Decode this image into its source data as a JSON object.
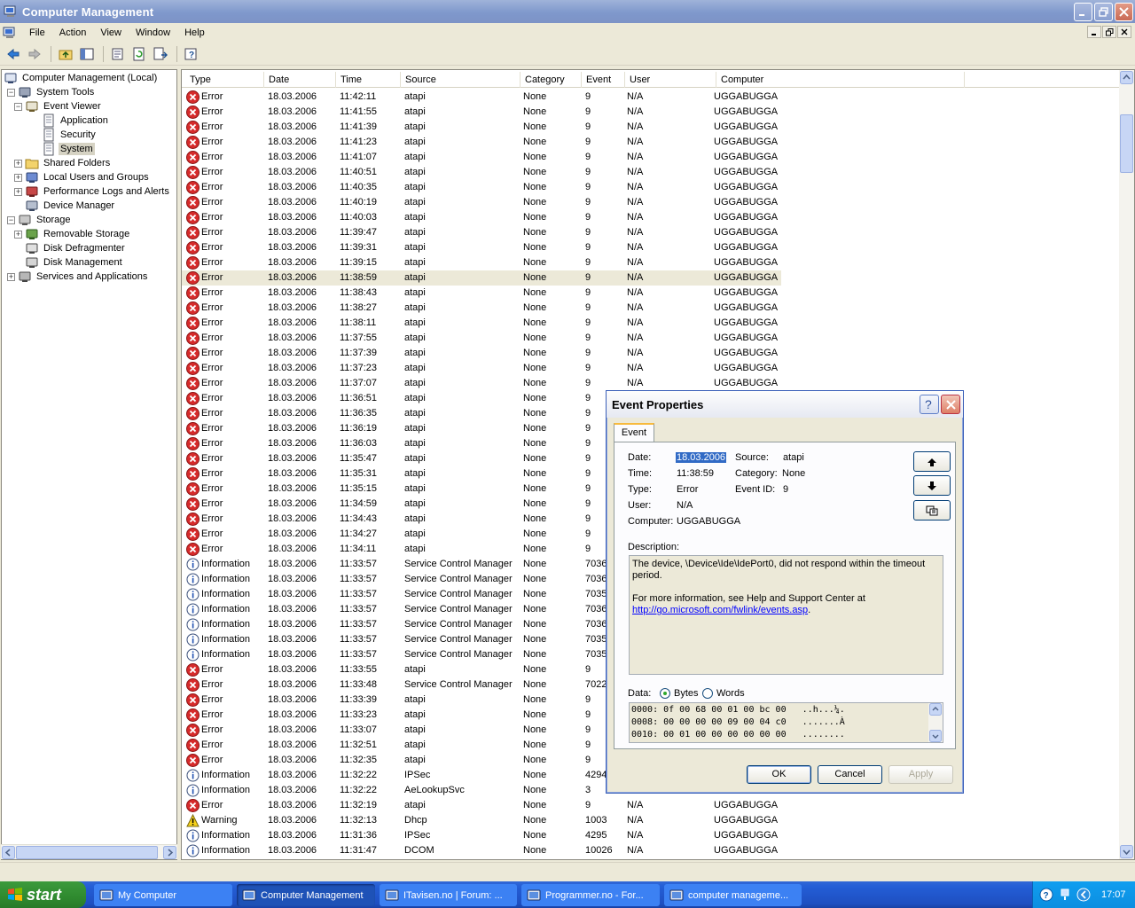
{
  "window": {
    "title": "Computer Management"
  },
  "menu": [
    "File",
    "Action",
    "View",
    "Window",
    "Help"
  ],
  "tree": [
    {
      "label": "Computer Management (Local)",
      "level": 0,
      "expander": "",
      "icon": "computer-icon"
    },
    {
      "label": "System Tools",
      "level": 1,
      "expander": "−",
      "icon": "tools-icon"
    },
    {
      "label": "Event Viewer",
      "level": 2,
      "expander": "−",
      "icon": "event-viewer-icon"
    },
    {
      "label": "Application",
      "level": 3,
      "expander": "",
      "icon": "log-icon"
    },
    {
      "label": "Security",
      "level": 3,
      "expander": "",
      "icon": "log-icon"
    },
    {
      "label": "System",
      "level": 3,
      "expander": "",
      "icon": "log-icon",
      "selected": true
    },
    {
      "label": "Shared Folders",
      "level": 2,
      "expander": "+",
      "icon": "folder-icon"
    },
    {
      "label": "Local Users and Groups",
      "level": 2,
      "expander": "+",
      "icon": "users-icon"
    },
    {
      "label": "Performance Logs and Alerts",
      "level": 2,
      "expander": "+",
      "icon": "performance-icon"
    },
    {
      "label": "Device Manager",
      "level": 2,
      "expander": "",
      "icon": "device-manager-icon"
    },
    {
      "label": "Storage",
      "level": 1,
      "expander": "−",
      "icon": "storage-icon"
    },
    {
      "label": "Removable Storage",
      "level": 2,
      "expander": "+",
      "icon": "removable-storage-icon"
    },
    {
      "label": "Disk Defragmenter",
      "level": 2,
      "expander": "",
      "icon": "defrag-icon"
    },
    {
      "label": "Disk Management",
      "level": 2,
      "expander": "",
      "icon": "disk-icon"
    },
    {
      "label": "Services and Applications",
      "level": 1,
      "expander": "+",
      "icon": "services-icon"
    }
  ],
  "columns": [
    "Type",
    "Date",
    "Time",
    "Source",
    "Category",
    "Event",
    "User",
    "Computer"
  ],
  "events": [
    {
      "type": "Error",
      "date": "18.03.2006",
      "time": "11:42:11",
      "source": "atapi",
      "category": "None",
      "event": "9",
      "user": "N/A",
      "computer": "UGGABUGGA"
    },
    {
      "type": "Error",
      "date": "18.03.2006",
      "time": "11:41:55",
      "source": "atapi",
      "category": "None",
      "event": "9",
      "user": "N/A",
      "computer": "UGGABUGGA"
    },
    {
      "type": "Error",
      "date": "18.03.2006",
      "time": "11:41:39",
      "source": "atapi",
      "category": "None",
      "event": "9",
      "user": "N/A",
      "computer": "UGGABUGGA"
    },
    {
      "type": "Error",
      "date": "18.03.2006",
      "time": "11:41:23",
      "source": "atapi",
      "category": "None",
      "event": "9",
      "user": "N/A",
      "computer": "UGGABUGGA"
    },
    {
      "type": "Error",
      "date": "18.03.2006",
      "time": "11:41:07",
      "source": "atapi",
      "category": "None",
      "event": "9",
      "user": "N/A",
      "computer": "UGGABUGGA"
    },
    {
      "type": "Error",
      "date": "18.03.2006",
      "time": "11:40:51",
      "source": "atapi",
      "category": "None",
      "event": "9",
      "user": "N/A",
      "computer": "UGGABUGGA"
    },
    {
      "type": "Error",
      "date": "18.03.2006",
      "time": "11:40:35",
      "source": "atapi",
      "category": "None",
      "event": "9",
      "user": "N/A",
      "computer": "UGGABUGGA"
    },
    {
      "type": "Error",
      "date": "18.03.2006",
      "time": "11:40:19",
      "source": "atapi",
      "category": "None",
      "event": "9",
      "user": "N/A",
      "computer": "UGGABUGGA"
    },
    {
      "type": "Error",
      "date": "18.03.2006",
      "time": "11:40:03",
      "source": "atapi",
      "category": "None",
      "event": "9",
      "user": "N/A",
      "computer": "UGGABUGGA"
    },
    {
      "type": "Error",
      "date": "18.03.2006",
      "time": "11:39:47",
      "source": "atapi",
      "category": "None",
      "event": "9",
      "user": "N/A",
      "computer": "UGGABUGGA"
    },
    {
      "type": "Error",
      "date": "18.03.2006",
      "time": "11:39:31",
      "source": "atapi",
      "category": "None",
      "event": "9",
      "user": "N/A",
      "computer": "UGGABUGGA"
    },
    {
      "type": "Error",
      "date": "18.03.2006",
      "time": "11:39:15",
      "source": "atapi",
      "category": "None",
      "event": "9",
      "user": "N/A",
      "computer": "UGGABUGGA"
    },
    {
      "type": "Error",
      "date": "18.03.2006",
      "time": "11:38:59",
      "source": "atapi",
      "category": "None",
      "event": "9",
      "user": "N/A",
      "computer": "UGGABUGGA",
      "highlight": true
    },
    {
      "type": "Error",
      "date": "18.03.2006",
      "time": "11:38:43",
      "source": "atapi",
      "category": "None",
      "event": "9",
      "user": "N/A",
      "computer": "UGGABUGGA"
    },
    {
      "type": "Error",
      "date": "18.03.2006",
      "time": "11:38:27",
      "source": "atapi",
      "category": "None",
      "event": "9",
      "user": "N/A",
      "computer": "UGGABUGGA"
    },
    {
      "type": "Error",
      "date": "18.03.2006",
      "time": "11:38:11",
      "source": "atapi",
      "category": "None",
      "event": "9",
      "user": "N/A",
      "computer": "UGGABUGGA"
    },
    {
      "type": "Error",
      "date": "18.03.2006",
      "time": "11:37:55",
      "source": "atapi",
      "category": "None",
      "event": "9",
      "user": "N/A",
      "computer": "UGGABUGGA"
    },
    {
      "type": "Error",
      "date": "18.03.2006",
      "time": "11:37:39",
      "source": "atapi",
      "category": "None",
      "event": "9",
      "user": "N/A",
      "computer": "UGGABUGGA"
    },
    {
      "type": "Error",
      "date": "18.03.2006",
      "time": "11:37:23",
      "source": "atapi",
      "category": "None",
      "event": "9",
      "user": "N/A",
      "computer": "UGGABUGGA"
    },
    {
      "type": "Error",
      "date": "18.03.2006",
      "time": "11:37:07",
      "source": "atapi",
      "category": "None",
      "event": "9",
      "user": "N/A",
      "computer": "UGGABUGGA"
    },
    {
      "type": "Error",
      "date": "18.03.2006",
      "time": "11:36:51",
      "source": "atapi",
      "category": "None",
      "event": "9",
      "user": "",
      "computer": ""
    },
    {
      "type": "Error",
      "date": "18.03.2006",
      "time": "11:36:35",
      "source": "atapi",
      "category": "None",
      "event": "9",
      "user": "",
      "computer": ""
    },
    {
      "type": "Error",
      "date": "18.03.2006",
      "time": "11:36:19",
      "source": "atapi",
      "category": "None",
      "event": "9",
      "user": "",
      "computer": ""
    },
    {
      "type": "Error",
      "date": "18.03.2006",
      "time": "11:36:03",
      "source": "atapi",
      "category": "None",
      "event": "9",
      "user": "",
      "computer": ""
    },
    {
      "type": "Error",
      "date": "18.03.2006",
      "time": "11:35:47",
      "source": "atapi",
      "category": "None",
      "event": "9",
      "user": "",
      "computer": ""
    },
    {
      "type": "Error",
      "date": "18.03.2006",
      "time": "11:35:31",
      "source": "atapi",
      "category": "None",
      "event": "9",
      "user": "",
      "computer": ""
    },
    {
      "type": "Error",
      "date": "18.03.2006",
      "time": "11:35:15",
      "source": "atapi",
      "category": "None",
      "event": "9",
      "user": "",
      "computer": ""
    },
    {
      "type": "Error",
      "date": "18.03.2006",
      "time": "11:34:59",
      "source": "atapi",
      "category": "None",
      "event": "9",
      "user": "",
      "computer": ""
    },
    {
      "type": "Error",
      "date": "18.03.2006",
      "time": "11:34:43",
      "source": "atapi",
      "category": "None",
      "event": "9",
      "user": "",
      "computer": ""
    },
    {
      "type": "Error",
      "date": "18.03.2006",
      "time": "11:34:27",
      "source": "atapi",
      "category": "None",
      "event": "9",
      "user": "",
      "computer": ""
    },
    {
      "type": "Error",
      "date": "18.03.2006",
      "time": "11:34:11",
      "source": "atapi",
      "category": "None",
      "event": "9",
      "user": "",
      "computer": ""
    },
    {
      "type": "Information",
      "date": "18.03.2006",
      "time": "11:33:57",
      "source": "Service Control Manager",
      "category": "None",
      "event": "7036",
      "user": "",
      "computer": ""
    },
    {
      "type": "Information",
      "date": "18.03.2006",
      "time": "11:33:57",
      "source": "Service Control Manager",
      "category": "None",
      "event": "7036",
      "user": "",
      "computer": ""
    },
    {
      "type": "Information",
      "date": "18.03.2006",
      "time": "11:33:57",
      "source": "Service Control Manager",
      "category": "None",
      "event": "7035",
      "user": "",
      "computer": ""
    },
    {
      "type": "Information",
      "date": "18.03.2006",
      "time": "11:33:57",
      "source": "Service Control Manager",
      "category": "None",
      "event": "7036",
      "user": "",
      "computer": ""
    },
    {
      "type": "Information",
      "date": "18.03.2006",
      "time": "11:33:57",
      "source": "Service Control Manager",
      "category": "None",
      "event": "7036",
      "user": "",
      "computer": ""
    },
    {
      "type": "Information",
      "date": "18.03.2006",
      "time": "11:33:57",
      "source": "Service Control Manager",
      "category": "None",
      "event": "7035",
      "user": "",
      "computer": ""
    },
    {
      "type": "Information",
      "date": "18.03.2006",
      "time": "11:33:57",
      "source": "Service Control Manager",
      "category": "None",
      "event": "7035",
      "user": "",
      "computer": ""
    },
    {
      "type": "Error",
      "date": "18.03.2006",
      "time": "11:33:55",
      "source": "atapi",
      "category": "None",
      "event": "9",
      "user": "",
      "computer": ""
    },
    {
      "type": "Error",
      "date": "18.03.2006",
      "time": "11:33:48",
      "source": "Service Control Manager",
      "category": "None",
      "event": "7022",
      "user": "",
      "computer": ""
    },
    {
      "type": "Error",
      "date": "18.03.2006",
      "time": "11:33:39",
      "source": "atapi",
      "category": "None",
      "event": "9",
      "user": "",
      "computer": ""
    },
    {
      "type": "Error",
      "date": "18.03.2006",
      "time": "11:33:23",
      "source": "atapi",
      "category": "None",
      "event": "9",
      "user": "",
      "computer": ""
    },
    {
      "type": "Error",
      "date": "18.03.2006",
      "time": "11:33:07",
      "source": "atapi",
      "category": "None",
      "event": "9",
      "user": "",
      "computer": ""
    },
    {
      "type": "Error",
      "date": "18.03.2006",
      "time": "11:32:51",
      "source": "atapi",
      "category": "None",
      "event": "9",
      "user": "",
      "computer": ""
    },
    {
      "type": "Error",
      "date": "18.03.2006",
      "time": "11:32:35",
      "source": "atapi",
      "category": "None",
      "event": "9",
      "user": "",
      "computer": ""
    },
    {
      "type": "Information",
      "date": "18.03.2006",
      "time": "11:32:22",
      "source": "IPSec",
      "category": "None",
      "event": "4294",
      "user": "",
      "computer": ""
    },
    {
      "type": "Information",
      "date": "18.03.2006",
      "time": "11:32:22",
      "source": "AeLookupSvc",
      "category": "None",
      "event": "3",
      "user": "",
      "computer": ""
    },
    {
      "type": "Error",
      "date": "18.03.2006",
      "time": "11:32:19",
      "source": "atapi",
      "category": "None",
      "event": "9",
      "user": "N/A",
      "computer": "UGGABUGGA"
    },
    {
      "type": "Warning",
      "date": "18.03.2006",
      "time": "11:32:13",
      "source": "Dhcp",
      "category": "None",
      "event": "1003",
      "user": "N/A",
      "computer": "UGGABUGGA"
    },
    {
      "type": "Information",
      "date": "18.03.2006",
      "time": "11:31:36",
      "source": "IPSec",
      "category": "None",
      "event": "4295",
      "user": "N/A",
      "computer": "UGGABUGGA"
    },
    {
      "type": "Information",
      "date": "18.03.2006",
      "time": "11:31:47",
      "source": "DCOM",
      "category": "None",
      "event": "10026",
      "user": "N/A",
      "computer": "UGGABUGGA"
    }
  ],
  "dialog": {
    "title": "Event Properties",
    "tab": "Event",
    "date_label": "Date:",
    "date_value": "18.03.2006",
    "source_label": "Source:",
    "source_value": "atapi",
    "time_label": "Time:",
    "time_value": "11:38:59",
    "category_label": "Category:",
    "category_value": "None",
    "type_label": "Type:",
    "type_value": "Error",
    "eventid_label": "Event ID:",
    "eventid_value": "9",
    "user_label": "User:",
    "user_value": "N/A",
    "computer_label": "Computer:",
    "computer_value": "UGGABUGGA",
    "description_label": "Description:",
    "description_line1": "The device, \\Device\\Ide\\IdePort0, did not respond within the timeout period.",
    "description_line2": "For more information, see Help and Support Center at",
    "description_link": "http://go.microsoft.com/fwlink/events.asp",
    "description_tail": ".",
    "data_label": "Data:",
    "data_bytes": "Bytes",
    "data_words": "Words",
    "data_lines": [
      "0000: 0f 00 68 00 01 00 bc 00   ..h...¼.",
      "0008: 00 00 00 00 09 00 04 c0   .......À",
      "0010: 00 01 00 00 00 00 00 00   ........"
    ],
    "ok": "OK",
    "cancel": "Cancel",
    "apply": "Apply"
  },
  "taskbar": {
    "start": "start",
    "tasks": [
      {
        "label": "My Computer",
        "icon": "my-computer-icon",
        "active": false
      },
      {
        "label": "Computer Management",
        "icon": "computer-management-icon",
        "active": true
      },
      {
        "label": "ITavisen.no | Forum: ...",
        "icon": "browser-icon",
        "active": false
      },
      {
        "label": "Programmer.no - For...",
        "icon": "browser-icon",
        "active": false
      },
      {
        "label": "computer manageme...",
        "icon": "image-editor-icon",
        "active": false
      }
    ],
    "clock": "17:07"
  },
  "colors": {
    "titlebar": "#7f98cc",
    "taskbar": "#245ed6",
    "start": "#2f8a2f",
    "highlight_row": "#ece9d8",
    "selection": "#316ac5"
  }
}
